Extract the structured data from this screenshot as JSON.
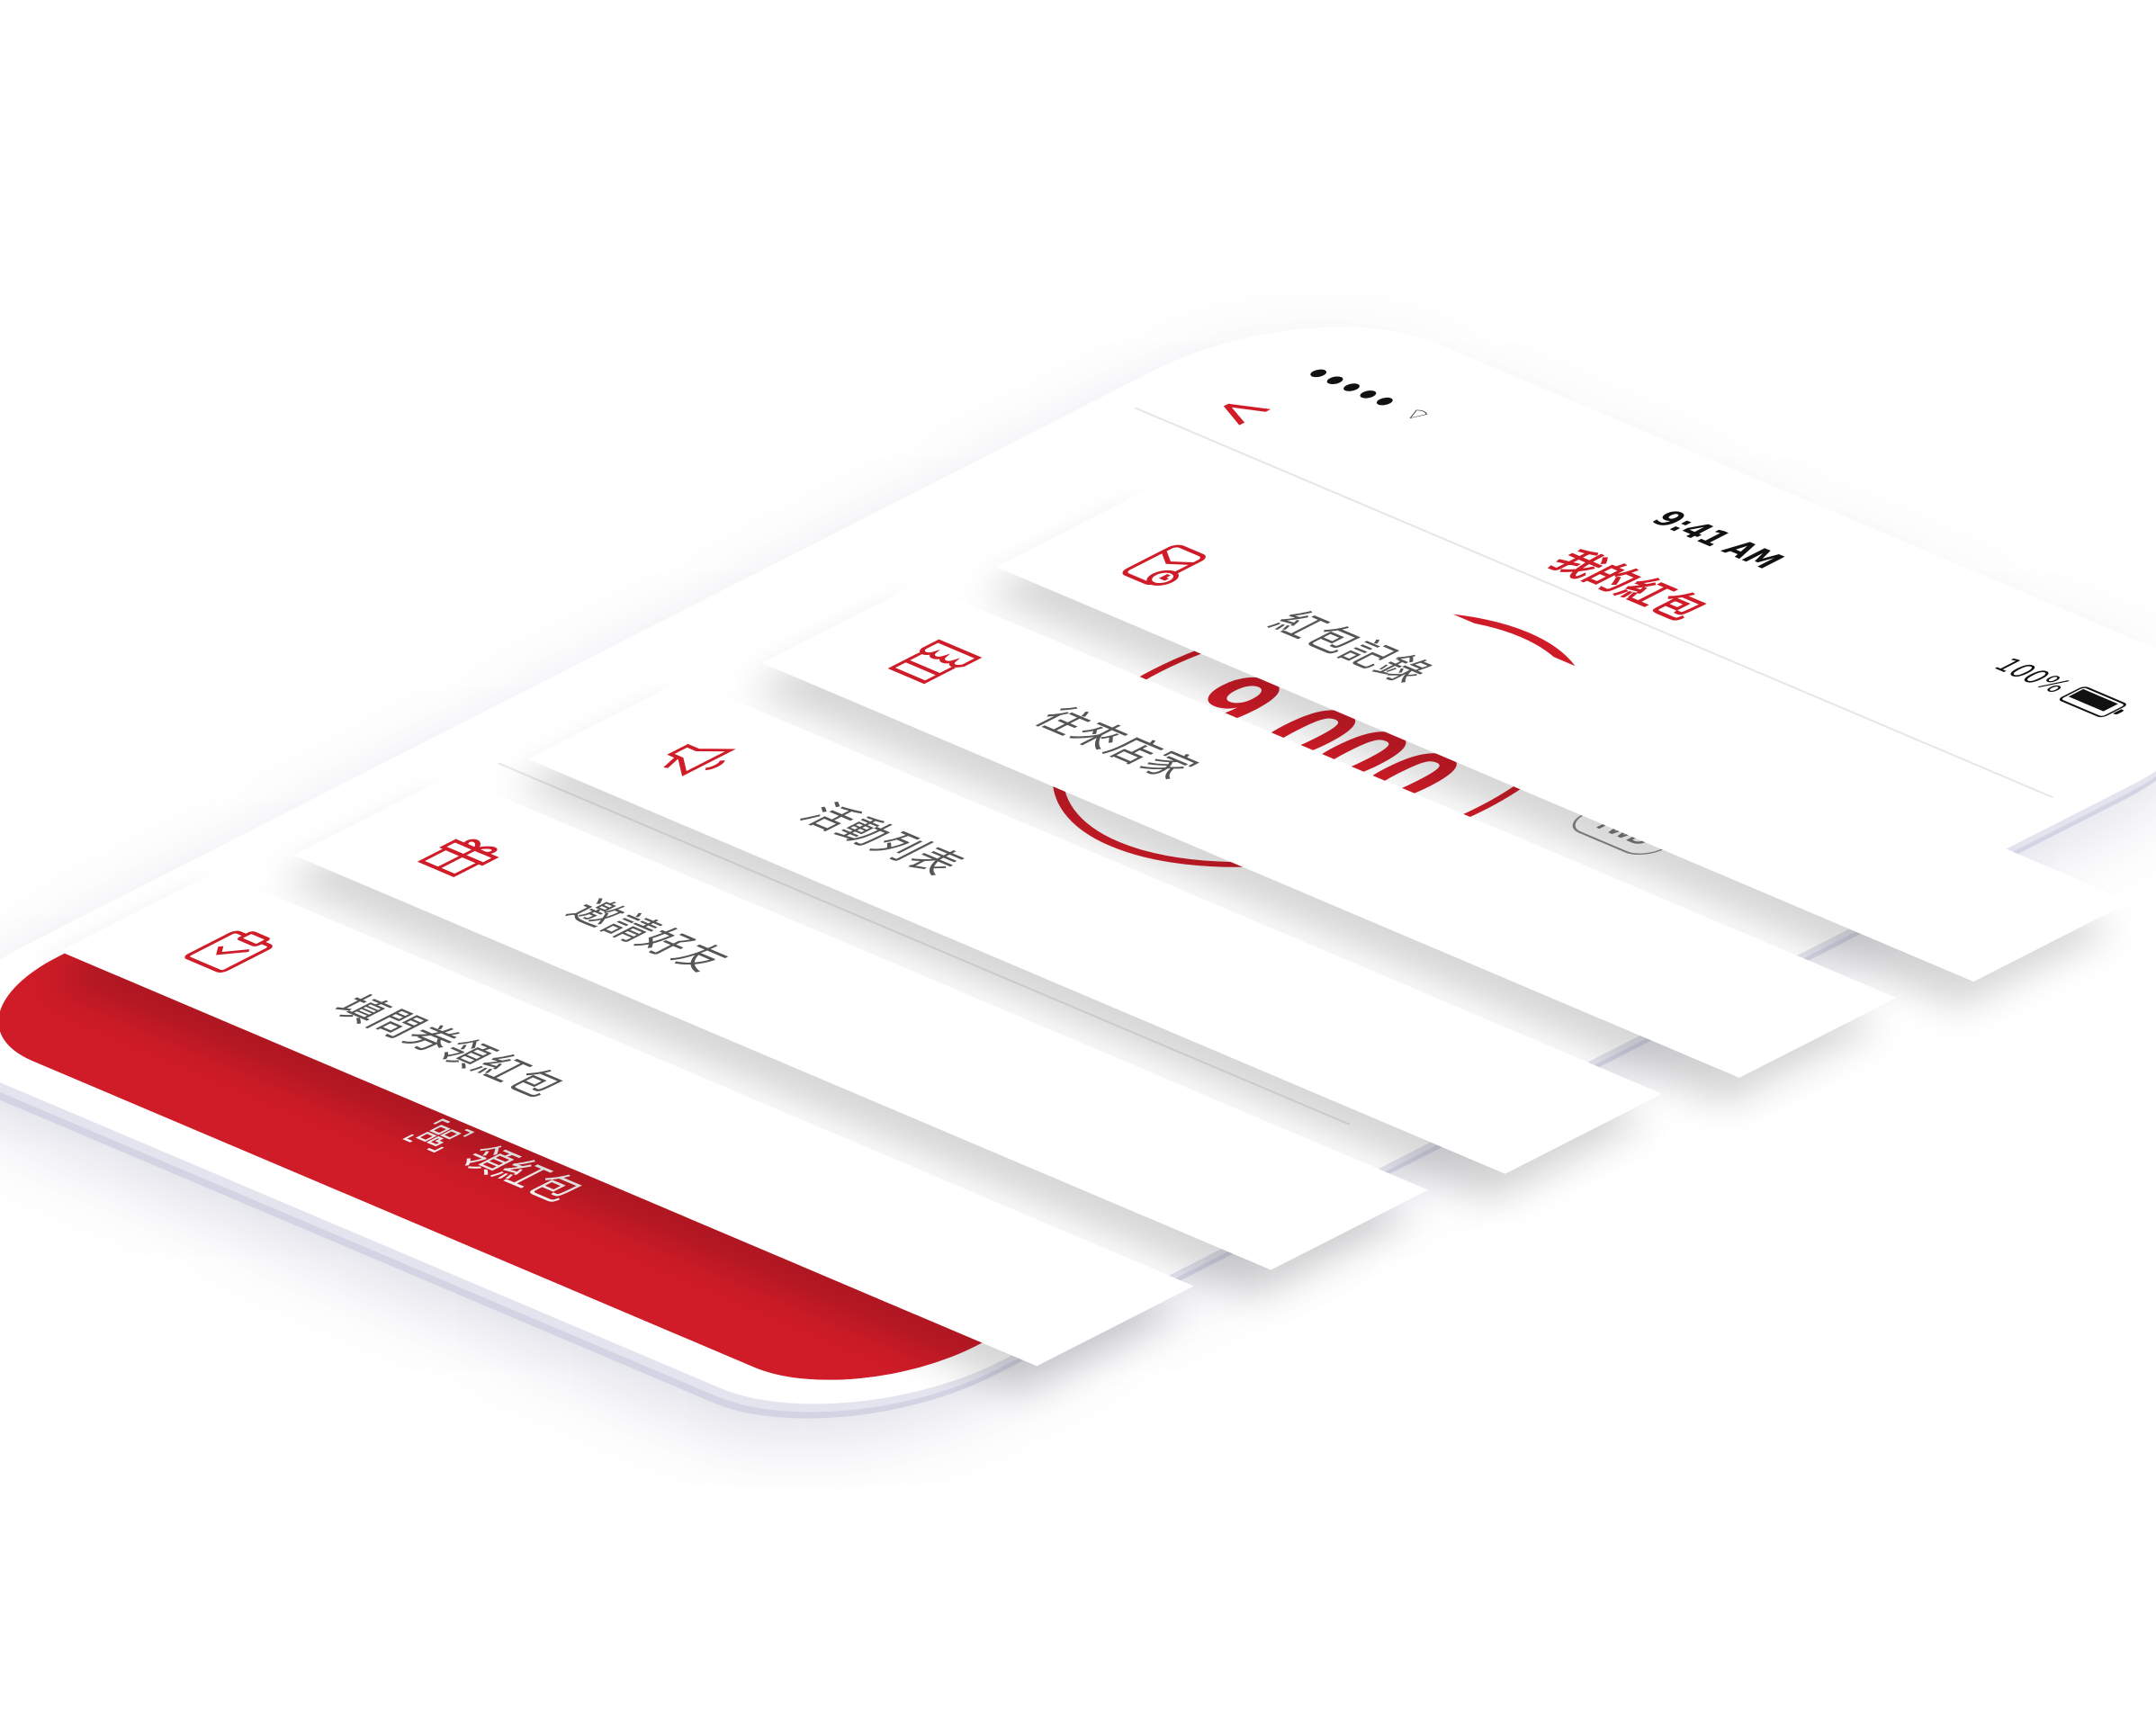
{
  "status_bar": {
    "time": "9:41 AM",
    "battery": "100%"
  },
  "nav": {
    "back": "<",
    "title": "我的紅包"
  },
  "balance": {
    "amount": "9,000",
    "currency": "TWD"
  },
  "menu": [
    {
      "icon": "red-envelope-clock-icon",
      "label": "紅包記錄"
    },
    {
      "icon": "shop-icon",
      "label": "往來店家"
    },
    {
      "icon": "megaphone-icon",
      "label": "活動列表"
    },
    {
      "icon": "gift-icon",
      "label": "邀請好友"
    },
    {
      "icon": "clipboard-check-icon",
      "label": "填問券領紅包"
    }
  ],
  "cta": {
    "icon": "qr-scan-icon",
    "label": "領紅包"
  },
  "colors": {
    "accent": "#cf1c28",
    "text": "#555555"
  }
}
